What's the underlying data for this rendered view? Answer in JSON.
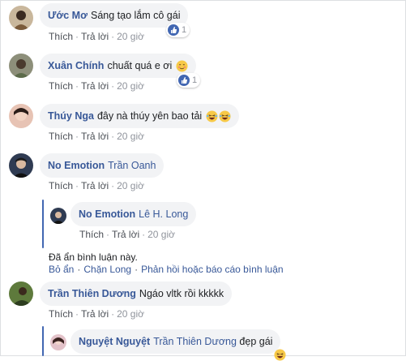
{
  "actions": {
    "like": "Thích",
    "reply": "Trả lời",
    "dot": "·"
  },
  "comments": [
    {
      "author": "Ước Mơ",
      "text": "Sáng tạo lắm cô gái",
      "time": "20 giờ",
      "reactions": "1"
    },
    {
      "author": "Xuân Chính",
      "text": "chuất quá e ơi",
      "time": "20 giờ",
      "reactions": "1"
    },
    {
      "author": "Thúy Nga",
      "text": "đây nà thúy yên bao tải",
      "time": "20 giờ"
    },
    {
      "author": "No Emotion",
      "mention": "Trần Oanh",
      "time": "20 giờ"
    },
    {
      "author": "No Emotion",
      "mention": "Lê H. Long",
      "time": "20 giờ"
    },
    {
      "author": "Trần Thiên Dương",
      "text": "Ngáo vltk rồi kkkkk",
      "time": "20 giờ"
    },
    {
      "author": "Nguyệt Nguyệt",
      "mention": "Trần Thiên Dương",
      "text": "đẹp gái"
    }
  ],
  "hidden": {
    "notice": "Đã ẩn bình luận này.",
    "unhide": "Bỏ ẩn",
    "block": "Chặn Long",
    "feedback": "Phản hồi hoặc báo cáo bình luận"
  },
  "colors": {
    "name": "#385898",
    "bubble": "#f2f3f5",
    "like": "#4267b2",
    "meta": "#90949c"
  }
}
